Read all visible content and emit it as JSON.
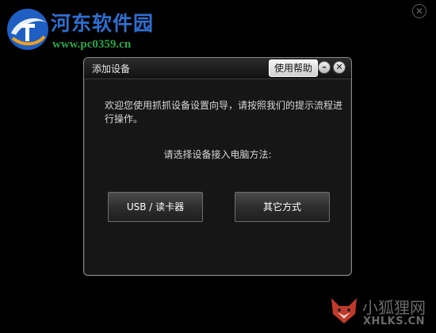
{
  "watermark": {
    "site_name": "河东软件园",
    "site_url": "www.pc0359.cn"
  },
  "dialog": {
    "title": "添加设备",
    "help_label": "使用帮助",
    "minimize_glyph": "–",
    "close_glyph": "✕",
    "welcome_text": "欢迎您使用抓抓设备设置向导，请按照我们的提示流程进行操作。",
    "prompt_text": "请选择设备接入电脑方法:",
    "options": [
      {
        "label": "USB / 读卡器"
      },
      {
        "label": "其它方式"
      }
    ]
  },
  "outer_close_glyph": "✕",
  "watermark2": {
    "name": "小狐狸网",
    "url": "XHLKS.CN"
  },
  "icons": {
    "site_logo": "hedong-logo-icon",
    "fox_logo": "fox-icon"
  },
  "colors": {
    "background": "#000000",
    "dialog_bg": "#161616",
    "watermark_blue": "#2e6fd1",
    "watermark_green": "#27a847"
  }
}
